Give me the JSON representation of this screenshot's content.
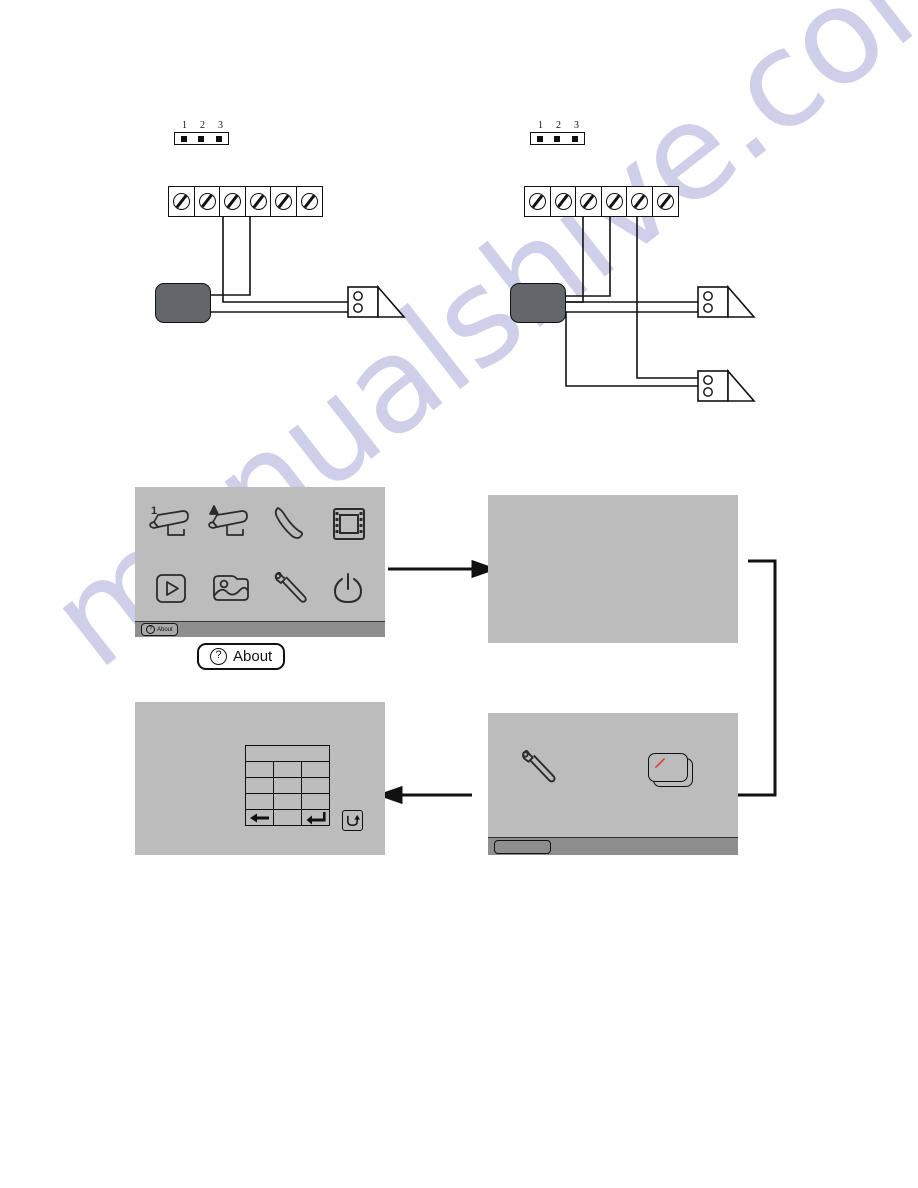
{
  "page": {
    "background_color": "#ffffff",
    "watermark_text": "manualshive.com",
    "watermark_color": "#8f8fcf"
  },
  "wiring_diagrams": [
    {
      "id": "single-sensor-wiring",
      "jumper": {
        "labels": [
          "1",
          "2",
          "3"
        ],
        "pin_count": 3
      },
      "terminal_block": {
        "terminal_count": 6,
        "icon": "screw-icon"
      },
      "device_box": {
        "label": "",
        "color": "#63666b"
      },
      "sensors": [
        {
          "id": "sensor-1",
          "terminal_dots": 2
        }
      ]
    },
    {
      "id": "dual-sensor-wiring",
      "jumper": {
        "labels": [
          "1",
          "2",
          "3"
        ],
        "pin_count": 3
      },
      "terminal_block": {
        "terminal_count": 6,
        "icon": "screw-icon"
      },
      "device_box": {
        "label": "",
        "color": "#63666b"
      },
      "sensors": [
        {
          "id": "sensor-1",
          "terminal_dots": 2
        },
        {
          "id": "sensor-2",
          "terminal_dots": 2
        }
      ]
    }
  ],
  "ui_flow": {
    "main_menu_screen": {
      "background_color": "#bcbcbc",
      "icons": [
        {
          "name": "camera-1-icon",
          "label": ""
        },
        {
          "name": "camera-alert-icon",
          "label": ""
        },
        {
          "name": "phone-handset-icon",
          "label": ""
        },
        {
          "name": "film-strip-icon",
          "label": ""
        },
        {
          "name": "play-button-icon",
          "label": ""
        },
        {
          "name": "photo-gallery-icon",
          "label": ""
        },
        {
          "name": "wrench-icon",
          "label": ""
        },
        {
          "name": "power-icon",
          "label": ""
        }
      ],
      "status_bar": {
        "background_color": "#8e8e8e",
        "about_button": {
          "label": "About",
          "icon": "question-mark-icon"
        }
      }
    },
    "about_callout": {
      "label": "About",
      "icon": "question-mark-icon"
    },
    "info_screen": {
      "background_color": "#bcbcbc",
      "content": ""
    },
    "tools_screen": {
      "background_color": "#bcbcbc",
      "items": [
        {
          "name": "wrench-icon",
          "label": ""
        },
        {
          "name": "note-block-icon",
          "label": "",
          "mark_color": "#e03030"
        }
      ],
      "bottom_bar": {
        "background_color": "#8e8e8e",
        "button_label": ""
      }
    },
    "keypad_screen": {
      "background_color": "#bcbcbc",
      "display_value": "",
      "keys": [
        {
          "name": "key-row1-col1",
          "label": ""
        },
        {
          "name": "key-row1-col2",
          "label": ""
        },
        {
          "name": "key-row1-col3",
          "label": ""
        },
        {
          "name": "key-row2-col1",
          "label": ""
        },
        {
          "name": "key-row2-col2",
          "label": ""
        },
        {
          "name": "key-row2-col3",
          "label": ""
        },
        {
          "name": "key-row3-col1",
          "label": ""
        },
        {
          "name": "key-row3-col2",
          "label": ""
        },
        {
          "name": "key-row3-col3",
          "label": ""
        },
        {
          "name": "key-backspace",
          "label": "",
          "icon": "left-arrow-icon"
        },
        {
          "name": "key-row4-col2",
          "label": ""
        },
        {
          "name": "key-enter",
          "label": "",
          "icon": "enter-arrow-icon"
        }
      ],
      "refresh_key": {
        "name": "refresh-icon",
        "label": ""
      }
    },
    "connectors": [
      {
        "name": "arrow-menu-to-info",
        "direction": "right"
      },
      {
        "name": "arrow-info-to-tools",
        "direction": "down-left"
      },
      {
        "name": "arrow-tools-to-keypad",
        "direction": "left"
      }
    ]
  }
}
